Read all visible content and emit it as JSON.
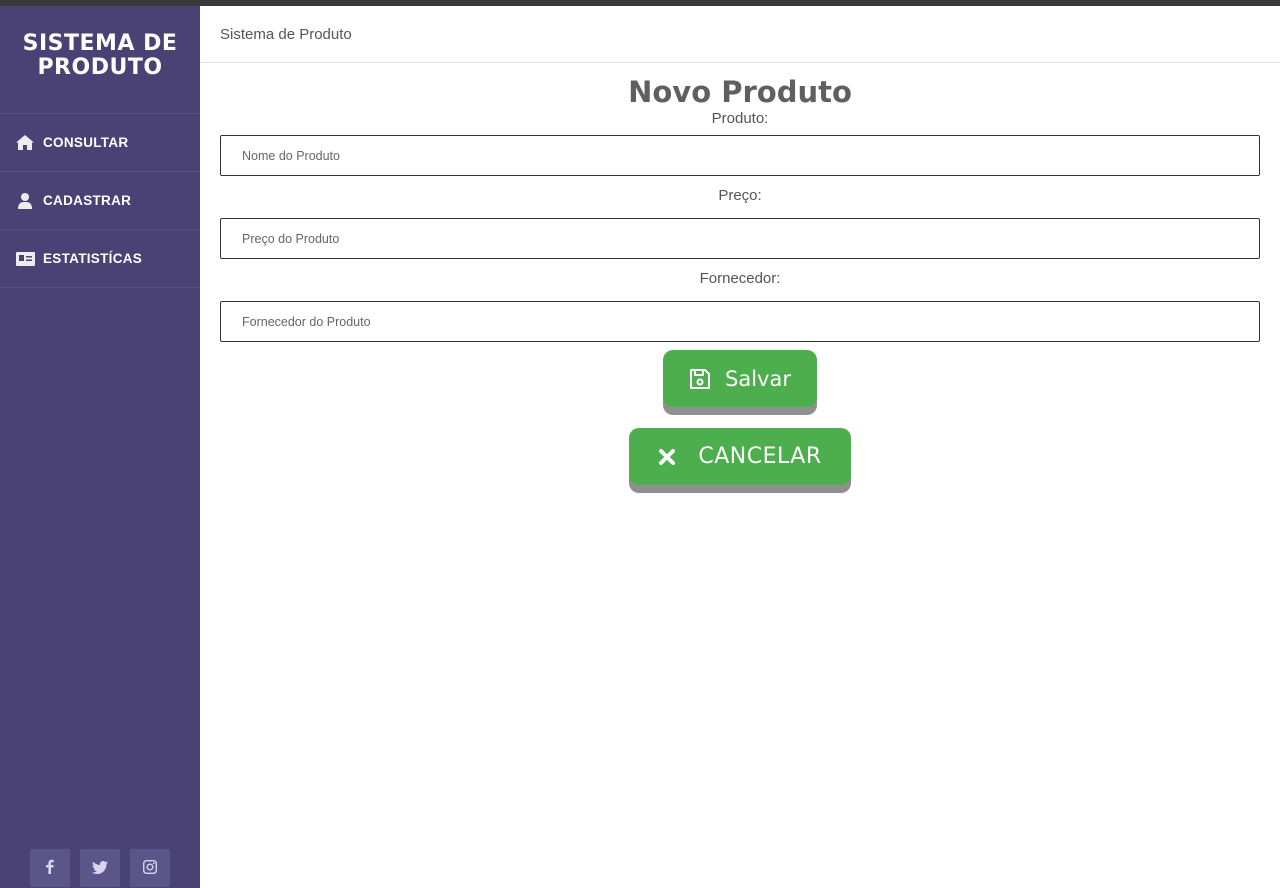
{
  "sidebar": {
    "brand": "SISTEMA DE PRODUTO",
    "items": [
      {
        "label": "CONSULTAR",
        "icon": "home-icon"
      },
      {
        "label": "CADASTRAR",
        "icon": "user-icon"
      },
      {
        "label": "ESTATISTÍCAS",
        "icon": "id-card-icon"
      }
    ],
    "social": [
      "facebook-icon",
      "twitter-icon",
      "instagram-icon"
    ]
  },
  "header": {
    "title": "Sistema de Produto"
  },
  "form": {
    "title": "Novo Produto",
    "fields": [
      {
        "label": "Produto:",
        "placeholder": "Nome do Produto",
        "value": ""
      },
      {
        "label": "Preço:",
        "placeholder": "Preço do Produto",
        "value": ""
      },
      {
        "label": "Fornecedor:",
        "placeholder": "Fornecedor do Produto",
        "value": ""
      }
    ],
    "save_label": "Salvar",
    "cancel_label": "CANCELAR"
  },
  "colors": {
    "sidebar_bg": "#4a4275",
    "button_green": "#4cae4c",
    "button_shadow": "#8f8f8f",
    "social_bg": "#5c5589"
  }
}
